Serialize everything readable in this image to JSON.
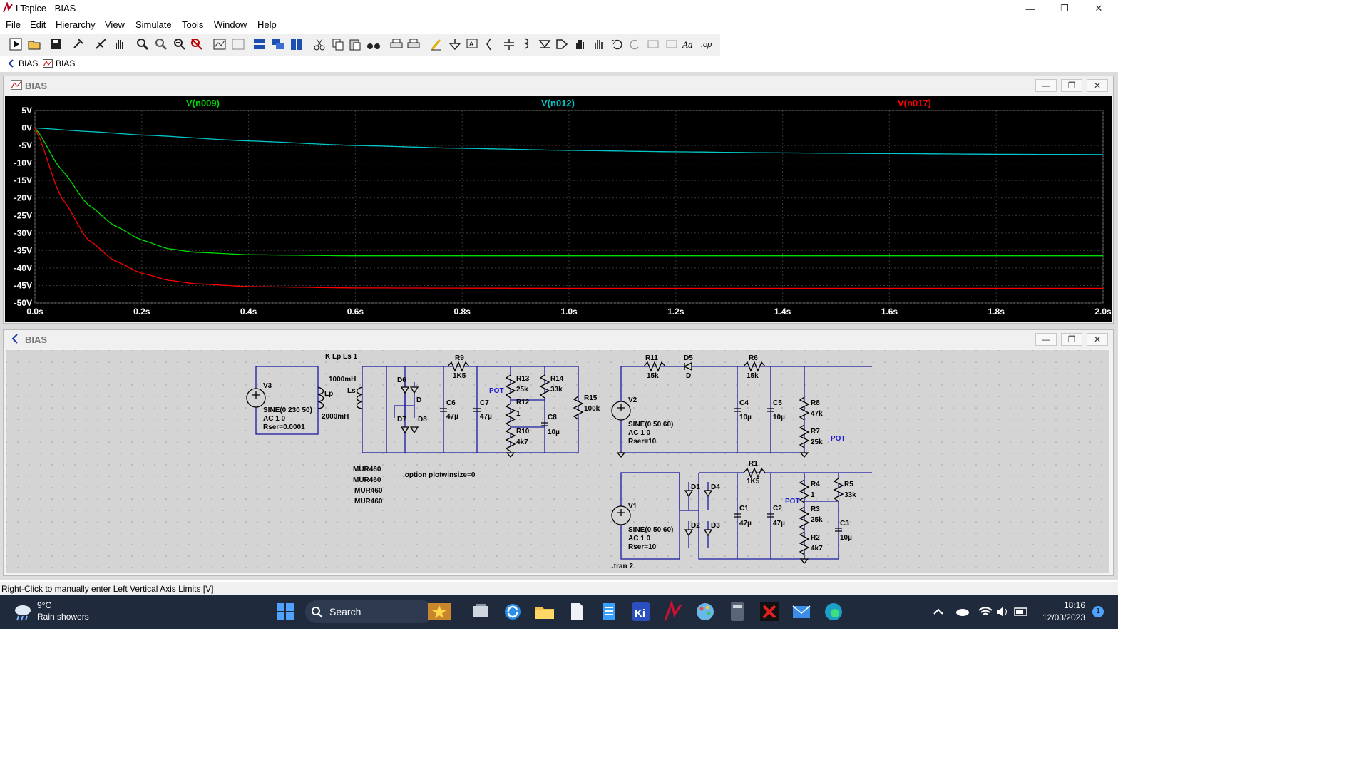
{
  "window": {
    "title": "LTspice - BIAS",
    "minimize": "—",
    "maximize": "❐",
    "close": "✕"
  },
  "menu": [
    "File",
    "Edit",
    "Hierarchy",
    "View",
    "Simulate",
    "Tools",
    "Window",
    "Help"
  ],
  "tabs": [
    {
      "label": "BIAS",
      "icon": "schematic-icon"
    },
    {
      "label": "BIAS",
      "icon": "waveform-icon"
    }
  ],
  "plot": {
    "window_title": "BIAS",
    "traces": [
      {
        "name": "V(n009)",
        "color": "#00dd00"
      },
      {
        "name": "V(n012)",
        "color": "#00c8c8"
      },
      {
        "name": "V(n017)",
        "color": "#ff0000"
      }
    ],
    "y_ticks": [
      "5V",
      "0V",
      "-5V",
      "-10V",
      "-15V",
      "-20V",
      "-25V",
      "-30V",
      "-35V",
      "-40V",
      "-45V",
      "-50V"
    ],
    "x_ticks": [
      "0.0s",
      "0.2s",
      "0.4s",
      "0.6s",
      "0.8s",
      "1.0s",
      "1.2s",
      "1.4s",
      "1.6s",
      "1.8s",
      "2.0s"
    ]
  },
  "chart_data": {
    "type": "line",
    "x_unit": "s",
    "y_unit": "V",
    "xlim": [
      0,
      2.0
    ],
    "ylim": [
      -50,
      5
    ],
    "series": [
      {
        "name": "V(n009)",
        "x": [
          0,
          0.05,
          0.1,
          0.15,
          0.2,
          0.25,
          0.3,
          0.4,
          0.6,
          1.0,
          1.5,
          2.0
        ],
        "values": [
          0,
          -12,
          -22,
          -28,
          -32,
          -34.5,
          -35.5,
          -36.2,
          -36.5,
          -36.5,
          -36.5,
          -36.5
        ]
      },
      {
        "name": "V(n012)",
        "x": [
          0,
          0.1,
          0.2,
          0.4,
          0.6,
          0.8,
          1.0,
          1.2,
          1.4,
          1.6,
          1.8,
          2.0
        ],
        "values": [
          0,
          -1,
          -2,
          -3.7,
          -5,
          -5.8,
          -6.4,
          -6.8,
          -7.1,
          -7.3,
          -7.5,
          -7.6
        ]
      },
      {
        "name": "V(n017)",
        "x": [
          0,
          0.05,
          0.1,
          0.15,
          0.2,
          0.25,
          0.3,
          0.4,
          0.6,
          1.0,
          1.5,
          2.0
        ],
        "values": [
          0,
          -20,
          -32,
          -38,
          -41.5,
          -43.5,
          -44.5,
          -45.3,
          -45.7,
          -45.8,
          -45.8,
          -45.8
        ]
      }
    ],
    "grid": true
  },
  "schematic": {
    "window_title": "BIAS",
    "labels": {
      "kline": "K Lp Ls 1",
      "lp_val": "1000mH",
      "ls": "Ls",
      "lp": "Lp",
      "ls_val": "2000mH",
      "v3": "V3",
      "v3_sine": "SINE(0 230 50)",
      "v3_ac": "AC 1 0",
      "v3_rser": "Rser=0.0001",
      "d6": "D6",
      "d": "D",
      "d7": "D7",
      "d8": "D8",
      "mur1": "MUR460",
      "mur2": "MUR460",
      "mur3": "MUR460",
      "mur4": "MUR460",
      "option": ".option plotwinsize=0",
      "r9": "R9",
      "r9v": "1K5",
      "c6": "C6",
      "c6v": "47µ",
      "c7": "C7",
      "c7v": "47µ",
      "pot1": "POT",
      "r13": "R13",
      "r13v": "25k",
      "r14": "R14",
      "r14v": "33k",
      "r12": "R12",
      "r12v": "1",
      "c8": "C8",
      "c8v": "10µ",
      "r10": "R10",
      "r10v": "4k7",
      "r15": "R15",
      "r15v": "100k",
      "r11": "R11",
      "r11v": "15k",
      "d5": "D5",
      "d5v": "D",
      "r6": "R6",
      "r6v": "15k",
      "v2": "V2",
      "v2_sine": "SINE(0 50 60)",
      "v2_ac": "AC 1 0",
      "v2_rser": "Rser=10",
      "c4": "C4",
      "c4v": "10µ",
      "c5": "C5",
      "c5v": "10µ",
      "r8": "R8",
      "r8v": "47k",
      "r7": "R7",
      "r7v": "25k",
      "pot2": "POT",
      "r1": "R1",
      "r1v": "1K5",
      "d1": "D1",
      "d4": "D4",
      "d2": "D2",
      "d3": "D3",
      "v1": "V1",
      "v1_sine": "SINE(0 50 60)",
      "v1_ac": "AC 1 0",
      "v1_rser": "Rser=10",
      "c1": "C1",
      "c1v": "47µ",
      "c2": "C2",
      "c2v": "47µ",
      "r4": "R4",
      "r4v": "1",
      "pot3": "POT",
      "r3": "R3",
      "r3v": "25k",
      "r5": "R5",
      "r5v": "33k",
      "c3": "C3",
      "c3v": "10µ",
      "r2": "R2",
      "r2v": "4k7",
      "tran": ".tran 2"
    }
  },
  "status": "Right-Click to manually enter Left Vertical Axis Limits [V]",
  "taskbar": {
    "weather_temp": "9°C",
    "weather_desc": "Rain showers",
    "search": "Search",
    "time": "18:16",
    "date": "12/03/2023",
    "notifications": "1"
  },
  "colors": {
    "plot_bg": "#000000",
    "grid": "#3a3a3a",
    "axis_text": "#ffffff",
    "wire": "#1a1aa0",
    "component": "#000000",
    "pot_label": "#1a1ad0",
    "schematic_bg": "#d4d4d4"
  }
}
